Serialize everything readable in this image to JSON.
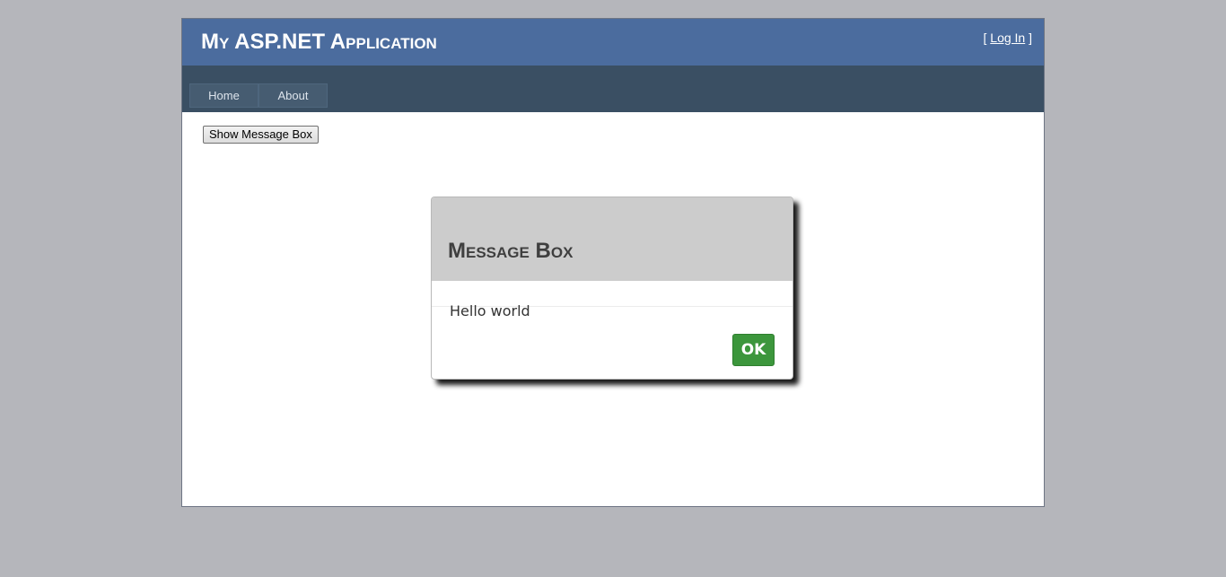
{
  "header": {
    "title": "My ASP.NET Application",
    "login": {
      "open_bracket": "[",
      "link_label": "Log In",
      "close_bracket": "]"
    }
  },
  "menu": {
    "items": [
      {
        "label": "Home"
      },
      {
        "label": "About"
      }
    ]
  },
  "main": {
    "show_button_label": "Show Message Box"
  },
  "dialog": {
    "title": "Message Box",
    "message": "Hello world",
    "ok_label": "OK"
  },
  "colors": {
    "background": "#b5b6bb",
    "header": "#4b6c9e",
    "menu_bar": "#3a4f63",
    "menu_item": "#465c71",
    "dialog_header": "#cccccc",
    "ok_button": "#3c963c"
  }
}
